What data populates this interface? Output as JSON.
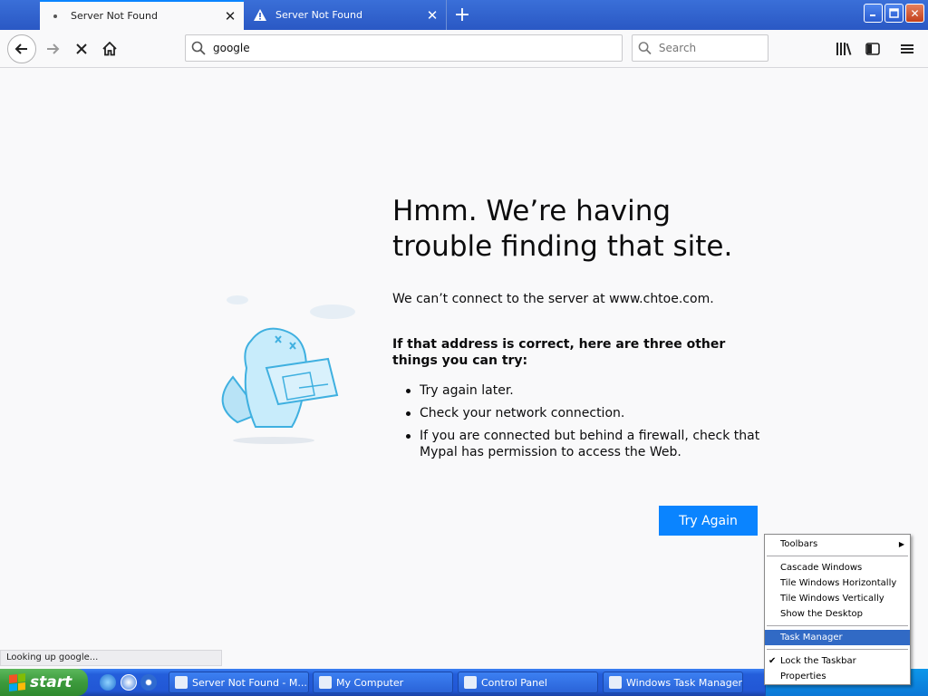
{
  "tabs": [
    {
      "label": "Server Not Found",
      "active": true
    },
    {
      "label": "Server Not Found",
      "active": false
    }
  ],
  "navbar": {
    "url_value": "google",
    "search_placeholder": "Search"
  },
  "error_page": {
    "title": "Hmm. We’re having trouble finding that site.",
    "description": "We can’t connect to the server at www.chtoe.com.",
    "subheading": "If that address is correct, here are three other things you can try:",
    "suggestions": [
      "Try again later.",
      "Check your network connection.",
      "If you are connected but behind a firewall, check that Mypal has permission to access the Web."
    ],
    "try_again_label": "Try Again"
  },
  "statusbar": {
    "text": "Looking up google..."
  },
  "taskbar": {
    "start_label": "start",
    "tasks": [
      {
        "label": "Server Not Found - M..."
      },
      {
        "label": "My Computer"
      },
      {
        "label": "Control Panel"
      },
      {
        "label": "Windows Task Manager"
      }
    ]
  },
  "context_menu": {
    "items": [
      {
        "label": "Toolbars",
        "submenu": true
      },
      {
        "label": "Cascade Windows"
      },
      {
        "label": "Tile Windows Horizontally"
      },
      {
        "label": "Tile Windows Vertically"
      },
      {
        "label": "Show the Desktop"
      },
      {
        "label": "Task Manager",
        "highlighted": true
      },
      {
        "label": "Lock the Taskbar",
        "checked": true
      },
      {
        "label": "Properties"
      }
    ]
  },
  "colors": {
    "accent": "#0a84ff",
    "menu_highlight": "#316ac5",
    "taskbar": "#245edb"
  }
}
